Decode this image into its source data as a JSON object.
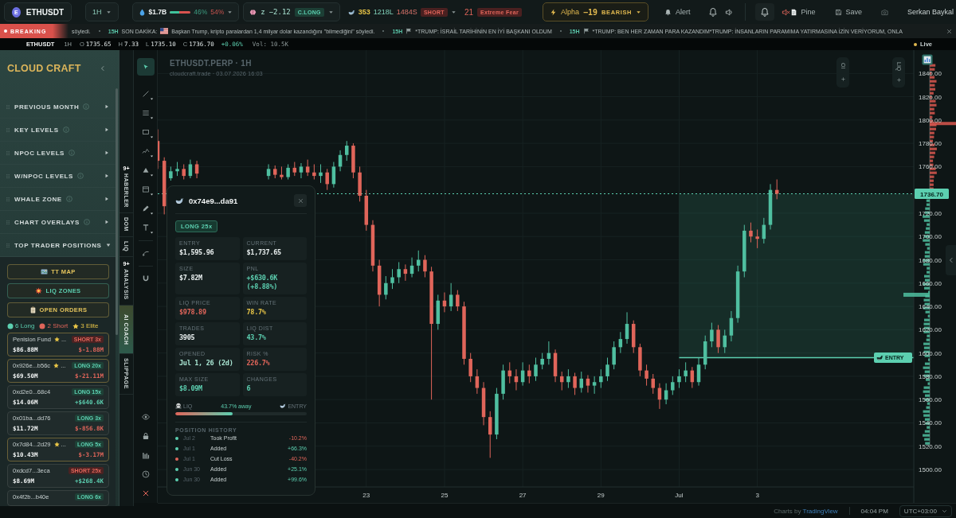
{
  "top_bar": {
    "symbol": {
      "letter": "E",
      "name": "ETHUSDT"
    },
    "interval": "1H",
    "liquidity": {
      "value": "$1.7B",
      "level": 0.46,
      "long_share": "46%",
      "short_share": "54%"
    },
    "zscore": {
      "label": "z",
      "value": "−2.12",
      "tag": "C.LONG"
    },
    "whales": {
      "count": "353",
      "longs": "1218L",
      "shorts": "1484S",
      "tag": "SHORT"
    },
    "fear_greed": {
      "value": "21",
      "label": "Extreme Fear"
    },
    "alpha": {
      "label": "Alpha",
      "value": "−19",
      "tag": "BEARISH"
    },
    "alert": "Alert",
    "sound_groups": [
      {
        "active": false,
        "muted": false
      },
      {
        "active": true,
        "muted": true
      }
    ],
    "pine": "Pine",
    "save": "Save",
    "user": "Serkan Baykal"
  },
  "ticker": {
    "label": "BREAKING",
    "items": [
      {
        "text": "söyledi."
      },
      {
        "age": "15H",
        "prefix": "SON DAKİKA:",
        "text": "Başkan Trump, kripto paralardan 1,4 milyar dolar kazandığını \"bilmediğini\" söyledi."
      },
      {
        "age": "15H",
        "text": "*TRUMP: İSRAİL TARİHİNİN EN İYİ BAŞKANI OLDUM"
      },
      {
        "age": "15H",
        "text": "*TRUMP: BEN HER ZAMAN PARA KAZANDIM*TRUMP: İNSANLARIN PARAMIMA YATIRMASINA İZİN VERİYORUM, ONLA"
      }
    ]
  },
  "quote": {
    "symbol": "ETHUSDT",
    "interval": "1H",
    "fields": [
      {
        "label": "O",
        "value": "1735.65"
      },
      {
        "label": "H",
        "value": "7.33"
      },
      {
        "label": "L",
        "value": "1735.10"
      },
      {
        "label": "C",
        "value": "1736.70"
      }
    ],
    "change": "+0.06%",
    "volume": "Vol: 10.5K",
    "live": "Live"
  },
  "sidebar": {
    "title": "CLOUD CRAFT",
    "sections": [
      {
        "label": "PREVIOUS MONTH",
        "info": true,
        "expanded": false
      },
      {
        "label": "KEY LEVELS",
        "info": true,
        "expanded": false
      },
      {
        "label": "NPOC LEVELS",
        "info": true,
        "expanded": false
      },
      {
        "label": "W/NPOC LEVELS",
        "info": true,
        "expanded": false
      },
      {
        "label": "WHALE ZONE",
        "info": true,
        "expanded": false
      },
      {
        "label": "CHART OVERLAYS",
        "info": true,
        "expanded": false
      },
      {
        "label": "TOP TRADER POSITIONS",
        "info": false,
        "expanded": true
      }
    ],
    "actions": [
      {
        "label": "TT MAP",
        "color": "#e3c35c"
      },
      {
        "label": "LIQ ZONES",
        "color": "#5ccfb0"
      },
      {
        "label": "OPEN ORDERS",
        "color": "#e3c35c"
      }
    ],
    "summary": [
      {
        "kind": "long",
        "text": "6 Long",
        "color": "#5ccfb0"
      },
      {
        "kind": "short",
        "text": "2 Short",
        "color": "#e0655a"
      },
      {
        "kind": "elite",
        "text": "3 Elite",
        "color": "#e8c547"
      }
    ],
    "traders": [
      {
        "name": "Penision Fund",
        "elite": true,
        "more": "...",
        "short": true,
        "tag": "SHORT 3x",
        "size": "$86.88M",
        "pnl": "$-1.88M",
        "pnl_up": false
      },
      {
        "name": "0x926e...b56c",
        "elite": true,
        "more": "...",
        "short": false,
        "tag": "LONG 20x",
        "size": "$69.50M",
        "pnl": "$-21.11M",
        "pnl_up": false
      },
      {
        "name": "0xd2e0...68c4",
        "elite": false,
        "short": false,
        "tag": "LONG 15x",
        "size": "$14.06M",
        "pnl": "+$640.6K",
        "pnl_up": true
      },
      {
        "name": "0x01ba...dd76",
        "elite": false,
        "short": false,
        "tag": "LONG 3x",
        "size": "$11.72M",
        "pnl": "$-856.8K",
        "pnl_up": false
      },
      {
        "name": "0x7d84...2d29",
        "elite": true,
        "more": "...",
        "short": false,
        "tag": "LONG 5x",
        "size": "$10.43M",
        "pnl": "$-3.17M",
        "pnl_up": false
      },
      {
        "name": "0xdcd7...3eca",
        "elite": false,
        "short": true,
        "tag": "SHORT 25x",
        "size": "$8.69M",
        "pnl": "+$268.4K",
        "pnl_up": true
      },
      {
        "name": "0x4f2b...b40e",
        "elite": false,
        "short": false,
        "tag": "LONG 6x"
      }
    ]
  },
  "side_tabs": [
    {
      "label": "HABERLER",
      "badge": "9+",
      "selected": false
    },
    {
      "label": "DOM",
      "selected": false
    },
    {
      "label": "LIQ",
      "selected": false
    },
    {
      "label": "ANALYSIS",
      "badge": "9+",
      "selected": false
    },
    {
      "label": "AI COACH",
      "selected": true
    },
    {
      "label": "SLIPPAGE",
      "selected": false
    }
  ],
  "toolbar": {
    "tools": [
      {
        "selected": true,
        "menu": false
      },
      {
        "selected": false,
        "menu": true
      },
      {
        "selected": false,
        "menu": true
      },
      {
        "selected": false,
        "menu": true
      },
      {
        "selected": false,
        "menu": true
      },
      {
        "selected": false,
        "menu": true
      },
      {
        "selected": false,
        "menu": true
      },
      {
        "selected": false,
        "menu": true
      },
      {
        "selected": false,
        "menu": true
      },
      {
        "selected": false,
        "menu": false
      },
      {
        "selected": false,
        "menu": false
      }
    ]
  },
  "chart": {
    "indicators": [
      {
        "label": "OI"
      },
      {
        "label": "LIQ"
      }
    ],
    "chart_data": [
      {
        "type": "candlestick",
        "title": "ETHUSDT.PERP · 1H",
        "subtitle": "cloudcraft.trade · 03.07.2026 16:03",
        "series": [
          {
            "x": [
              "2026-06-17T16:00",
              "2026-06-17T20:00",
              "2026-06-18T00:00",
              "2026-06-18T04:00",
              "2026-06-18T08:00",
              "2026-06-18T12:00",
              "2026-06-18T16:00",
              "2026-06-20T12:00",
              "2026-06-20T16:00",
              "2026-06-20T20:00",
              "2026-06-21T00:00",
              "2026-06-21T04:00",
              "2026-06-21T08:00",
              "2026-06-21T12:00",
              "2026-06-21T16:00",
              "2026-06-21T20:00",
              "2026-06-22T00:00",
              "2026-06-22T04:00",
              "2026-06-22T08:00",
              "2026-06-22T12:00",
              "2026-06-22T16:00",
              "2026-06-22T20:00",
              "2026-06-23T00:00",
              "2026-06-23T04:00",
              "2026-06-23T08:00",
              "2026-06-23T12:00",
              "2026-06-23T16:00",
              "2026-06-23T20:00",
              "2026-06-24T00:00",
              "2026-06-24T04:00",
              "2026-06-24T08:00",
              "2026-06-24T12:00",
              "2026-06-24T16:00",
              "2026-06-24T20:00",
              "2026-06-25T00:00",
              "2026-06-25T04:00",
              "2026-06-25T08:00",
              "2026-06-25T12:00",
              "2026-06-25T16:00",
              "2026-06-25T20:00",
              "2026-06-26T00:00",
              "2026-06-26T04:00",
              "2026-06-26T08:00",
              "2026-06-26T12:00",
              "2026-06-26T16:00",
              "2026-06-26T20:00",
              "2026-06-27T00:00",
              "2026-06-27T04:00",
              "2026-06-27T08:00",
              "2026-06-27T12:00",
              "2026-06-27T16:00",
              "2026-06-27T20:00",
              "2026-06-28T00:00",
              "2026-06-28T04:00",
              "2026-06-28T08:00",
              "2026-06-28T12:00",
              "2026-06-28T16:00",
              "2026-06-28T20:00",
              "2026-06-29T00:00",
              "2026-06-29T04:00",
              "2026-06-29T08:00",
              "2026-06-29T12:00",
              "2026-06-29T16:00",
              "2026-06-29T20:00",
              "2026-06-30T00:00",
              "2026-06-30T04:00",
              "2026-06-30T08:00",
              "2026-06-30T12:00",
              "2026-06-30T16:00",
              "2026-06-30T20:00",
              "2026-07-01T00:00",
              "2026-07-01T04:00",
              "2026-07-01T08:00",
              "2026-07-01T12:00",
              "2026-07-01T16:00",
              "2026-07-01T20:00",
              "2026-07-02T00:00",
              "2026-07-02T04:00",
              "2026-07-02T08:00",
              "2026-07-02T12:00",
              "2026-07-02T16:00",
              "2026-07-02T20:00",
              "2026-07-03T00:00",
              "2026-07-03T04:00",
              "2026-07-03T08:00",
              "2026-07-03T12:00"
            ],
            "ohlc": [
              [
                1782,
                1792,
                1758,
                1765
              ],
              [
                1765,
                1768,
                1719,
                1726
              ],
              [
                1750,
                1760,
                1748,
                1756
              ],
              [
                1756,
                1764,
                1752,
                1758
              ],
              [
                1758,
                1762,
                1749,
                1752
              ],
              [
                1752,
                1766,
                1750,
                1762
              ],
              [
                1762,
                1765,
                1750,
                1754
              ],
              [
                1752,
                1762,
                1749,
                1758
              ],
              [
                1758,
                1761,
                1750,
                1753
              ],
              [
                1753,
                1760,
                1749,
                1751
              ],
              [
                1751,
                1762,
                1749,
                1759
              ],
              [
                1759,
                1764,
                1752,
                1755
              ],
              [
                1755,
                1763,
                1750,
                1760
              ],
              [
                1760,
                1766,
                1752,
                1755
              ],
              [
                1755,
                1762,
                1749,
                1752
              ],
              [
                1752,
                1762,
                1746,
                1755
              ],
              [
                1755,
                1758,
                1740,
                1745
              ],
              [
                1745,
                1764,
                1742,
                1760
              ],
              [
                1760,
                1774,
                1756,
                1770
              ],
              [
                1770,
                1782,
                1765,
                1778
              ],
              [
                1778,
                1780,
                1750,
                1755
              ],
              [
                1755,
                1760,
                1730,
                1735
              ],
              [
                1735,
                1740,
                1705,
                1710
              ],
              [
                1710,
                1714,
                1670,
                1675
              ],
              [
                1675,
                1680,
                1640,
                1650
              ],
              [
                1650,
                1666,
                1646,
                1660
              ],
              [
                1660,
                1672,
                1655,
                1665
              ],
              [
                1665,
                1678,
                1660,
                1672
              ],
              [
                1672,
                1676,
                1662,
                1668
              ],
              [
                1668,
                1682,
                1665,
                1675
              ],
              [
                1675,
                1688,
                1670,
                1680
              ],
              [
                1680,
                1684,
                1665,
                1670
              ],
              [
                1670,
                1674,
                1560,
                1625
              ],
              [
                1625,
                1650,
                1620,
                1645
              ],
              [
                1645,
                1652,
                1635,
                1640
              ],
              [
                1640,
                1660,
                1636,
                1650
              ],
              [
                1650,
                1654,
                1636,
                1640
              ],
              [
                1640,
                1644,
                1590,
                1595
              ],
              [
                1595,
                1600,
                1575,
                1580
              ],
              [
                1580,
                1586,
                1565,
                1570
              ],
              [
                1570,
                1575,
                1538,
                1545
              ],
              [
                1545,
                1550,
                1510,
                1530
              ],
              [
                1530,
                1570,
                1526,
                1565
              ],
              [
                1565,
                1590,
                1560,
                1585
              ],
              [
                1585,
                1592,
                1574,
                1580
              ],
              [
                1580,
                1586,
                1568,
                1575
              ],
              [
                1575,
                1592,
                1572,
                1585
              ],
              [
                1585,
                1590,
                1574,
                1580
              ],
              [
                1580,
                1596,
                1576,
                1590
              ],
              [
                1590,
                1600,
                1586,
                1595
              ],
              [
                1595,
                1610,
                1590,
                1600
              ],
              [
                1600,
                1603,
                1575,
                1580
              ],
              [
                1580,
                1584,
                1568,
                1575
              ],
              [
                1575,
                1586,
                1570,
                1580
              ],
              [
                1580,
                1583,
                1564,
                1570
              ],
              [
                1570,
                1584,
                1566,
                1578
              ],
              [
                1578,
                1581,
                1566,
                1572
              ],
              [
                1572,
                1580,
                1565,
                1575
              ],
              [
                1575,
                1586,
                1570,
                1580
              ],
              [
                1580,
                1596,
                1576,
                1590
              ],
              [
                1590,
                1610,
                1586,
                1605
              ],
              [
                1605,
                1618,
                1600,
                1612
              ],
              [
                1612,
                1635,
                1608,
                1625
              ],
              [
                1625,
                1628,
                1600,
                1605
              ],
              [
                1605,
                1608,
                1580,
                1585
              ],
              [
                1585,
                1590,
                1572,
                1578
              ],
              [
                1578,
                1582,
                1565,
                1570
              ],
              [
                1570,
                1574,
                1552,
                1560
              ],
              [
                1560,
                1574,
                1556,
                1568
              ],
              [
                1568,
                1580,
                1564,
                1575
              ],
              [
                1575,
                1586,
                1570,
                1580
              ],
              [
                1580,
                1592,
                1575,
                1585
              ],
              [
                1585,
                1588,
                1570,
                1575
              ],
              [
                1575,
                1596,
                1572,
                1590
              ],
              [
                1590,
                1615,
                1586,
                1610
              ],
              [
                1610,
                1626,
                1605,
                1620
              ],
              [
                1620,
                1624,
                1600,
                1605
              ],
              [
                1605,
                1620,
                1600,
                1615
              ],
              [
                1615,
                1636,
                1610,
                1630
              ],
              [
                1630,
                1675,
                1626,
                1670
              ],
              [
                1670,
                1710,
                1665,
                1705
              ],
              [
                1705,
                1712,
                1695,
                1700
              ],
              [
                1700,
                1706,
                1690,
                1698
              ],
              [
                1698,
                1716,
                1694,
                1710
              ],
              [
                1710,
                1745,
                1706,
                1740
              ],
              [
                1740,
                1749,
                1732,
                1736.7
              ]
            ]
          },
          {
            "type": "line",
            "name": "ENTRY",
            "x": [
              "2026-07-01T00:00",
              "2026-07-07T00:00"
            ],
            "values": [
              1596,
              1596
            ],
            "color": "#5ccfb0"
          }
        ],
        "xlim": [
          "2026-06-17T16:00",
          "2026-07-07T00:00"
        ],
        "ylim": [
          1485,
          1860
        ],
        "xticks": [
          {
            "value": "2026-06-23",
            "label": "23"
          },
          {
            "value": "2026-06-25",
            "label": "25"
          },
          {
            "value": "2026-06-27",
            "label": "27"
          },
          {
            "value": "2026-06-29",
            "label": "29"
          },
          {
            "value": "2026-07-01",
            "label": "Jul"
          },
          {
            "value": "2026-07-03",
            "label": "3"
          }
        ],
        "yticks": [
          {
            "value": 1500,
            "label": "1500.00"
          },
          {
            "value": 1520,
            "label": "1520.00"
          },
          {
            "value": 1540,
            "label": "1540.00"
          },
          {
            "value": 1560,
            "label": "1560.00"
          },
          {
            "value": 1580,
            "label": "1580.00"
          },
          {
            "value": 1600,
            "label": "1600.00"
          },
          {
            "value": 1620,
            "label": "1620.00"
          },
          {
            "value": 1640,
            "label": "1640.00"
          },
          {
            "value": 1660,
            "label": "1660.00"
          },
          {
            "value": 1680,
            "label": "1680.00"
          },
          {
            "value": 1700,
            "label": "1700.00"
          },
          {
            "value": 1720,
            "label": "1720.00"
          },
          {
            "value": 1760,
            "label": "1760.00"
          },
          {
            "value": 1780,
            "label": "1780.00"
          },
          {
            "value": 1800,
            "label": "1800.00"
          },
          {
            "value": 1820,
            "label": "1820.00"
          },
          {
            "value": 1840,
            "label": "1840.00"
          }
        ],
        "grid": true,
        "ref_lines": [
          {
            "axis": "y",
            "value": 1736.7,
            "label": "1736.70",
            "color": "#5ccfb0",
            "line_style": "dotted"
          }
        ]
      }
    ]
  },
  "position_card": {
    "address": "0x74e9...da91",
    "tag": "LONG 25x",
    "stats": [
      {
        "label": "ENTRY",
        "value": "$1,595.96",
        "color": "#e8eeee"
      },
      {
        "label": "CURRENT",
        "value": "$1,737.65",
        "color": "#e8eeee"
      },
      {
        "label": "SIZE",
        "value": "$7.82M",
        "color": "#e8eeee"
      },
      {
        "label": "PNL",
        "value": "+$630.6K (+8.88%)",
        "color": "#5ccfb0"
      },
      {
        "label": "LIQ PRICE",
        "value": "$978.89",
        "color": "#e0655a"
      },
      {
        "label": "WIN RATE",
        "value": "78.7%",
        "color": "#e8c547"
      },
      {
        "label": "TRADES",
        "value": "3905",
        "color": "#e8eeee"
      },
      {
        "label": "LIQ DIST",
        "value": "43.7%",
        "color": "#5ccfb0"
      },
      {
        "label": "OPENED",
        "value": "Jul 1, 26 (2d)",
        "color": "#a9e6d3"
      },
      {
        "label": "RISK %",
        "value": "226.7%",
        "color": "#e0655a"
      },
      {
        "label": "MAX SIZE",
        "value": "$8.09M",
        "color": "#5ccfb0"
      },
      {
        "label": "CHANGES",
        "value": "6",
        "color": "#5ccfb0"
      }
    ],
    "distance": {
      "left": "LIQ",
      "middle": "43.7% away",
      "right": "ENTRY",
      "level": 0.437
    },
    "history_title": "POSITION HISTORY",
    "history": [
      {
        "date": "Jul 2",
        "action": "Took Profit",
        "change": "-10.2%",
        "up": false,
        "color": "#5ccfb0"
      },
      {
        "date": "Jul 1",
        "action": "Added",
        "change": "+66.3%",
        "up": true,
        "color": "#5ccfb0"
      },
      {
        "date": "Jul 1",
        "action": "Cut Loss",
        "change": "-40.2%",
        "up": false,
        "color": "#e0655a"
      },
      {
        "date": "Jun 30",
        "action": "Added",
        "change": "+25.1%",
        "up": true,
        "color": "#5ccfb0"
      },
      {
        "date": "Jun 30",
        "action": "Added",
        "change": "+99.6%",
        "up": true,
        "color": "#5ccfb0"
      }
    ]
  },
  "status_bar": {
    "credit": {
      "text": "Charts by",
      "link": "TradingView"
    },
    "time": "04:04 PM",
    "timezone": "UTC+03:00"
  }
}
